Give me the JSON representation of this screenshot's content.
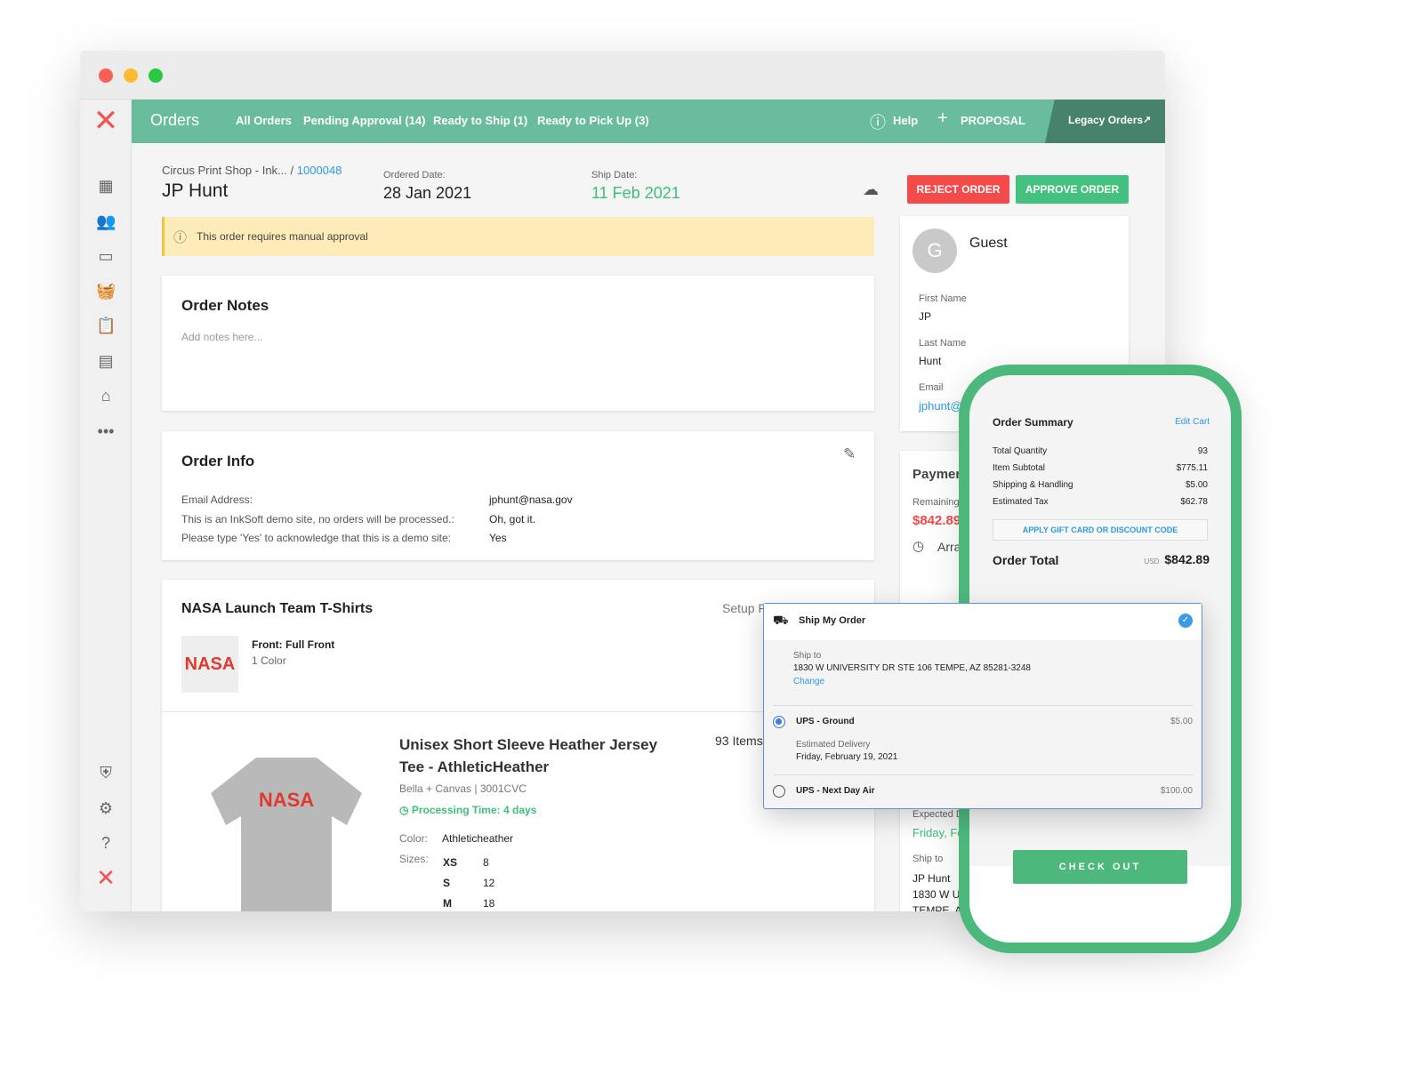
{
  "colors": {
    "header": "#69bd9d",
    "accent_green": "#4cb87c",
    "reject": "#f44a4a",
    "link": "#2a9ae5",
    "warning_bg": "#fdebb8"
  },
  "header": {
    "title": "Orders",
    "tabs": [
      "All Orders",
      "Pending Approval (14)",
      "Ready to Ship (1)",
      "Ready to Pick Up (3)"
    ],
    "help": "Help",
    "proposal": "PROPOSAL",
    "legacy": "Legacy Orders"
  },
  "order": {
    "breadcrumb": "Circus Print Shop - Ink...",
    "sep": "/",
    "order_id": "1000048",
    "customer": "JP Hunt",
    "ordered_label": "Ordered Date:",
    "ordered": "28 Jan 2021",
    "ship_label": "Ship Date:",
    "ship": "11 Feb 2021",
    "reject": "REJECT ORDER",
    "approve": "APPROVE ORDER",
    "warning": "This order requires manual approval"
  },
  "notes": {
    "title": "Order Notes",
    "placeholder": "Add notes here..."
  },
  "info": {
    "title": "Order Info",
    "rows": [
      {
        "k": "Email Address:",
        "v": "jphunt@nasa.gov"
      },
      {
        "k": "This is an InkSoft demo site, no orders will be processed.:",
        "v": "Oh, got it."
      },
      {
        "k": "Please type 'Yes' to acknowledge that this is a demo site:",
        "v": "Yes"
      }
    ]
  },
  "product": {
    "group": "NASA Launch Team T-Shirts",
    "setup": "Setup F",
    "decoration": "Front: Full Front",
    "colors_count": "1 Color",
    "logo": "NASA",
    "name": "Unisex Short Sleeve Heather Jersey Tee - AthleticHeather",
    "brand": "Bella + Canvas | 3001CVC",
    "processing": "Processing Time: 4 days",
    "items": "93 Items",
    "color_label": "Color:",
    "color": "Athleticheather",
    "sizes_label": "Sizes:",
    "sizes": [
      {
        "s": "XS",
        "q": "8"
      },
      {
        "s": "S",
        "q": "12"
      },
      {
        "s": "M",
        "q": "18"
      }
    ]
  },
  "customer": {
    "avatar": "G",
    "name": "Guest",
    "first_label": "First Name",
    "first": "JP",
    "last_label": "Last Name",
    "last": "Hunt",
    "email_label": "Email",
    "email": "jphunt@"
  },
  "payment": {
    "title": "Paymen",
    "remaining_label": "Remaining",
    "remaining": "$842.89",
    "arr": "Arra",
    "expected_label": "Expected D",
    "expected": "Friday, Fe",
    "ship_label": "Ship to",
    "ship_name": "JP Hunt",
    "ship_l1": "1830 W U",
    "ship_l2": "TEMPE, A"
  },
  "summary": {
    "title": "Order Summary",
    "edit": "Edit Cart",
    "rows": [
      {
        "k": "Total Quantity",
        "v": "93"
      },
      {
        "k": "Item Subtotal",
        "v": "$775.11"
      },
      {
        "k": "Shipping & Handling",
        "v": "$5.00"
      },
      {
        "k": "Estimated Tax",
        "v": "$62.78"
      }
    ],
    "gift": "APPLY GIFT CARD OR DISCOUNT CODE",
    "total_label": "Order Total",
    "currency": "USD",
    "total": "$842.89",
    "checkout": "CHECK OUT"
  },
  "shipping": {
    "title": "Ship My Order",
    "ship_to": "Ship to",
    "address": "1830 W UNIVERSITY DR STE 106 TEMPE, AZ 85281-3248",
    "change": "Change",
    "options": [
      {
        "name": "UPS - Ground",
        "price": "$5.00",
        "selected": true,
        "est_label": "Estimated Delivery",
        "est": "Friday, February 19, 2021"
      },
      {
        "name": "UPS - Next Day Air",
        "price": "$100.00",
        "selected": false
      }
    ]
  }
}
